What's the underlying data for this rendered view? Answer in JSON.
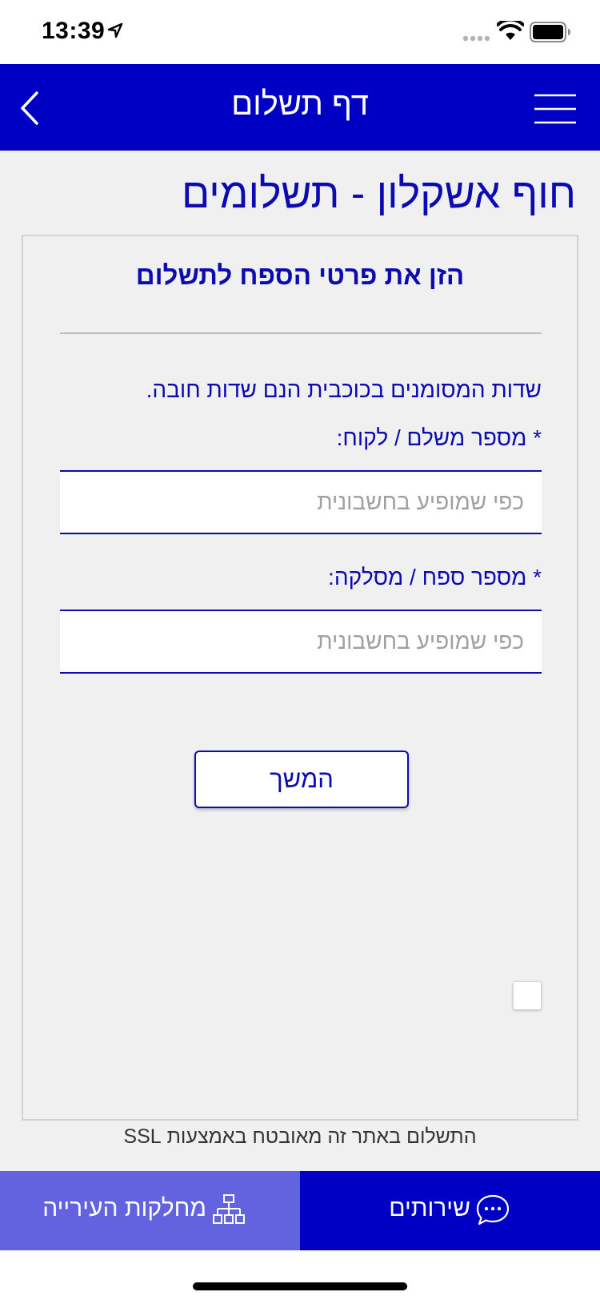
{
  "status_bar": {
    "time": "13:39"
  },
  "header": {
    "title": "דף תשלום"
  },
  "page": {
    "title": "חוף אשקלון - תשלומים"
  },
  "form": {
    "heading": "הזן את פרטי הספח לתשלום",
    "required_note": "שדות המסומנים בכוכבית הנם שדות חובה.",
    "payer_label": "* מספר משלם / לקוח:",
    "payer_placeholder": "כפי שמופיע בחשבונית",
    "payer_value": "",
    "voucher_label": "* מספר ספח / מסלקה:",
    "voucher_placeholder": "כפי שמופיע בחשבונית",
    "voucher_value": "",
    "continue_label": "המשך"
  },
  "ssl_note": "התשלום באתר זה מאובטח באמצעות SSL",
  "bottom_nav": {
    "departments_label": "מחלקות העירייה",
    "services_label": "שירותים"
  },
  "colors": {
    "brand_blue": "#0000c4",
    "text_blue": "#0b0bb0",
    "nav_light_blue": "#6363e0",
    "background": "#f0f0f0"
  },
  "icons": {
    "back": "chevron-left-icon",
    "menu": "hamburger-menu-icon",
    "departments": "org-chart-icon",
    "services": "chat-bubble-icon",
    "location": "location-arrow-icon",
    "wifi": "wifi-icon",
    "battery": "battery-icon"
  }
}
